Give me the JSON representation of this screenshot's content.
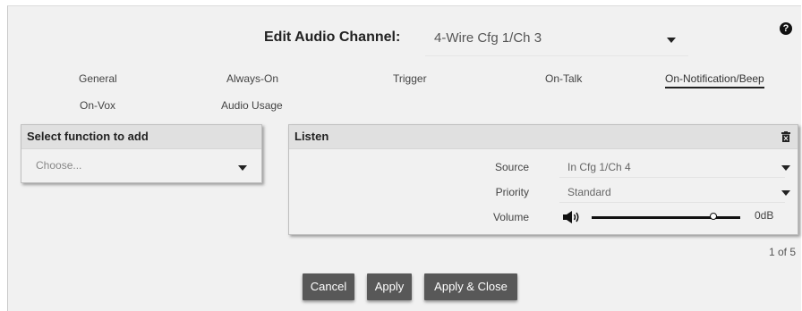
{
  "header": {
    "title": "Edit Audio Channel:",
    "channel_value": "4-Wire Cfg 1/Ch 3",
    "help_glyph": "?"
  },
  "tabs": [
    {
      "label": "General",
      "active": false
    },
    {
      "label": "Always-On",
      "active": false
    },
    {
      "label": "Trigger",
      "active": false
    },
    {
      "label": "On-Talk",
      "active": false
    },
    {
      "label": "On-Notification/Beep",
      "active": true
    },
    {
      "label": "On-Vox",
      "active": false
    },
    {
      "label": "Audio Usage",
      "active": false
    }
  ],
  "function_panel": {
    "title": "Select function to add",
    "placeholder": "Choose..."
  },
  "listen_panel": {
    "title": "Listen",
    "source_label": "Source",
    "source_value": "In Cfg 1/Ch 4",
    "priority_label": "Priority",
    "priority_value": "Standard",
    "volume_label": "Volume",
    "volume_value": "0dB",
    "volume_level": 0.82
  },
  "pager": "1 of 5",
  "buttons": {
    "cancel": "Cancel",
    "apply": "Apply",
    "apply_close": "Apply & Close"
  },
  "colors": {
    "button_bg": "#585858",
    "panel_bg": "#f1f1f1",
    "panel_header": "#e0e0e0"
  }
}
